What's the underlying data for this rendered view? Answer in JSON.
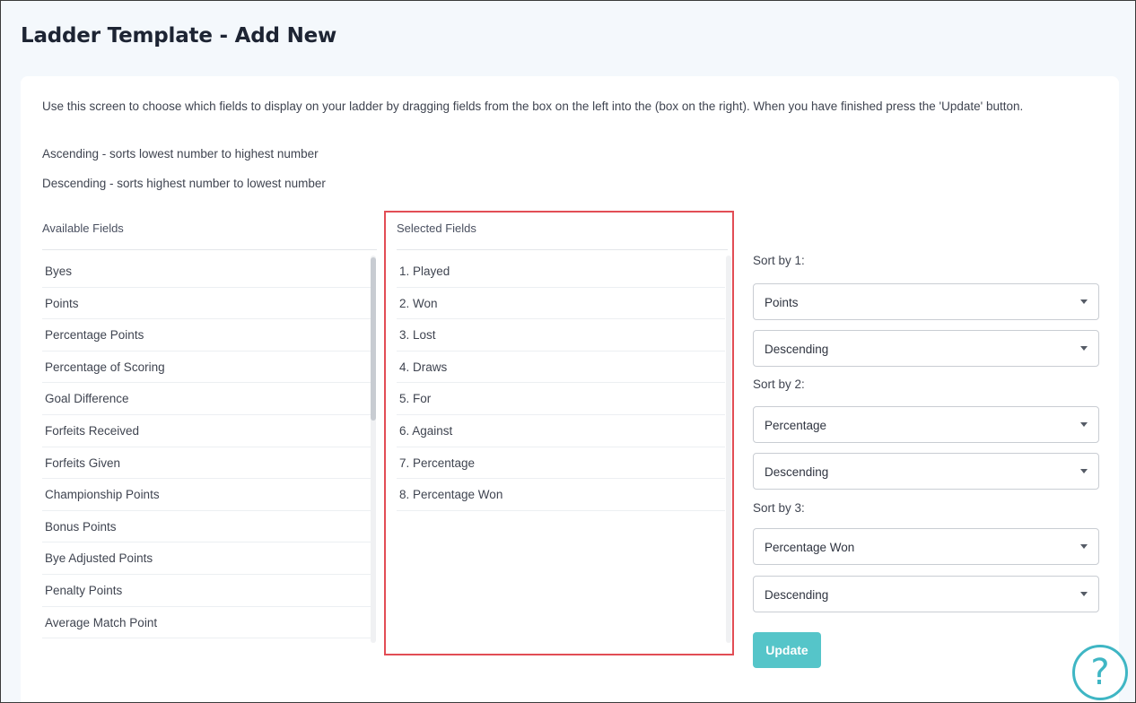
{
  "page": {
    "title": "Ladder Template - Add New"
  },
  "intro": {
    "line1": "Use this screen to choose which fields to display on your ladder by dragging fields from the box on the left into the (box on the right). When you have finished press the 'Update' button.",
    "line2": "Ascending - sorts lowest number to highest number",
    "line3": "Descending - sorts highest number to lowest number"
  },
  "available": {
    "header": "Available Fields",
    "items": [
      "Byes",
      "Points",
      "Percentage Points",
      "Percentage of Scoring",
      "Goal Difference",
      "Forfeits Received",
      "Forfeits Given",
      "Championship Points",
      "Bonus Points",
      "Bye Adjusted Points",
      "Penalty Points",
      "Average Match Point"
    ]
  },
  "selected": {
    "header": "Selected Fields",
    "items": [
      "1. Played",
      "2. Won",
      "3. Lost",
      "4. Draws",
      "5. For",
      "6. Against",
      "7. Percentage",
      "8. Percentage Won"
    ]
  },
  "sort": {
    "label1": "Sort by 1:",
    "field1": "Points",
    "order1": "Descending",
    "label2": "Sort by 2:",
    "field2": "Percentage",
    "order2": "Descending",
    "label3": "Sort by 3:",
    "field3": "Percentage Won",
    "order3": "Descending"
  },
  "actions": {
    "update_label": "Update",
    "help_label": "?"
  },
  "colors": {
    "accent": "#55c5c9",
    "highlight": "#e24d55",
    "help": "#3fb6c4"
  }
}
